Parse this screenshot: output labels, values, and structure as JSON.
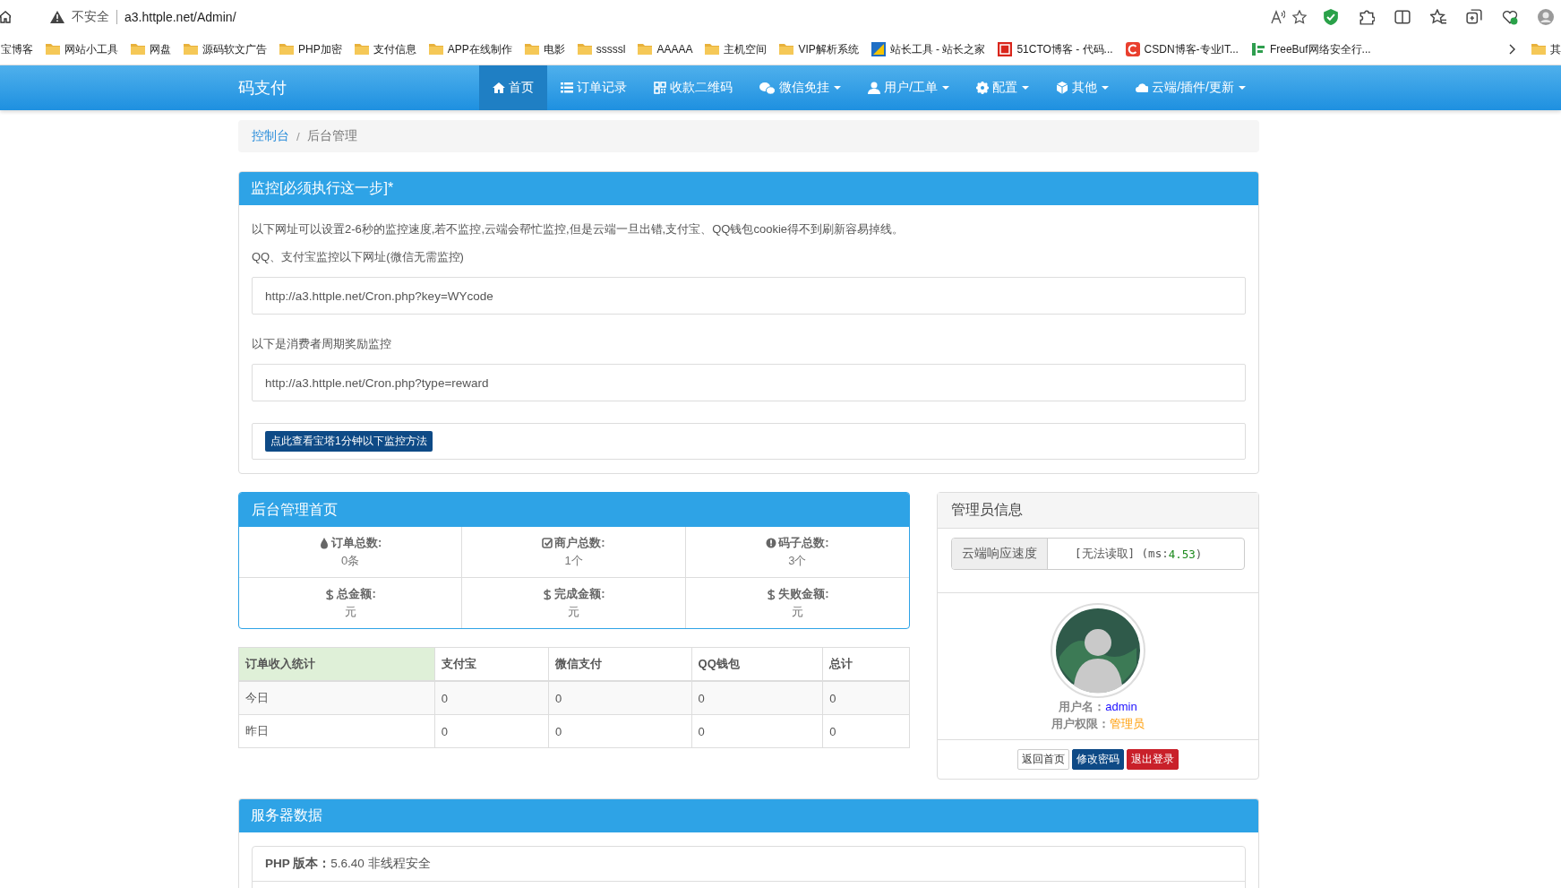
{
  "browser": {
    "address_warning": "不安全",
    "url": "a3.httple.net/Admin/",
    "bookmarks": [
      {
        "label": "宝博客",
        "kind": "none"
      },
      {
        "label": "网站小工具",
        "kind": "folder"
      },
      {
        "label": "网盘",
        "kind": "folder"
      },
      {
        "label": "源码软文广告",
        "kind": "folder"
      },
      {
        "label": "PHP加密",
        "kind": "folder"
      },
      {
        "label": "支付信息",
        "kind": "folder"
      },
      {
        "label": "APP在线制作",
        "kind": "folder"
      },
      {
        "label": "电影",
        "kind": "folder"
      },
      {
        "label": "sssssl",
        "kind": "folder"
      },
      {
        "label": "AAAAA",
        "kind": "folder"
      },
      {
        "label": "主机空间",
        "kind": "folder"
      },
      {
        "label": "VIP解析系统",
        "kind": "folder"
      },
      {
        "label": "站长工具 - 站长之家",
        "kind": "chart"
      },
      {
        "label": "51CTO博客 - 代码...",
        "kind": "square"
      },
      {
        "label": "CSDN博客-专业IT...",
        "kind": "ring"
      },
      {
        "label": "FreeBuf网络安全行...",
        "kind": "bars"
      }
    ],
    "overflow_folder": "其"
  },
  "navbar": {
    "brand": "码支付",
    "items": [
      {
        "label": "首页",
        "dropdown": false,
        "selected": true
      },
      {
        "label": "订单记录",
        "dropdown": false,
        "selected": false
      },
      {
        "label": "收款二维码",
        "dropdown": false,
        "selected": false
      },
      {
        "label": "微信免挂",
        "dropdown": true,
        "selected": false
      },
      {
        "label": "用户/工单",
        "dropdown": true,
        "selected": false
      },
      {
        "label": "配置",
        "dropdown": true,
        "selected": false
      },
      {
        "label": "其他",
        "dropdown": true,
        "selected": false
      },
      {
        "label": "云端/插件/更新",
        "dropdown": true,
        "selected": false
      }
    ]
  },
  "breadcrumb": {
    "separator": "/",
    "items": [
      {
        "label": "控制台",
        "link": true
      },
      {
        "label": "后台管理",
        "link": false
      }
    ]
  },
  "monitor": {
    "title": "监控[必须执行这一步]*",
    "note": "以下网址可以设置2-6秒的监控速度,若不监控,云端会帮忙监控,但是云端一旦出错,支付宝、QQ钱包cookie得不到刷新容易掉线。",
    "fields": [
      {
        "label": "QQ、支付宝监控以下网址(微信无需监控)",
        "value": "http://a3.httple.net/Cron.php?key=WYcode"
      },
      {
        "label": "以下是消费者周期奖励监控",
        "value": "http://a3.httple.net/Cron.php?type=reward"
      }
    ],
    "button": "点此查看宝塔1分钟以下监控方法"
  },
  "dashboard": {
    "title": "后台管理首页",
    "stats": [
      {
        "label": "订单总数:",
        "value": "0条"
      },
      {
        "label": "商户总数:",
        "value": "1个"
      },
      {
        "label": "码子总数:",
        "value": "3个"
      },
      {
        "label": "总金额:",
        "value": "元"
      },
      {
        "label": "完成金额:",
        "value": "元"
      },
      {
        "label": "失败金额:",
        "value": "元"
      }
    ],
    "income_table": {
      "columns": [
        {
          "label": "订单收入统计",
          "highlighted": true
        },
        {
          "label": "支付宝",
          "highlighted": false
        },
        {
          "label": "微信支付",
          "highlighted": false
        },
        {
          "label": "QQ钱包",
          "highlighted": false
        },
        {
          "label": "总计",
          "highlighted": false
        }
      ],
      "rows": [
        [
          "今日",
          "0",
          "0",
          "0",
          "0"
        ],
        [
          "昨日",
          "0",
          "0",
          "0",
          "0"
        ]
      ]
    }
  },
  "admin": {
    "title": "管理员信息",
    "speed": {
      "label": "云端响应速度",
      "status": "[无法读取] (ms:",
      "ms": "4.53",
      "suffix": ")"
    },
    "username_label": "用户名：",
    "username": "admin",
    "role_label": "用户权限：",
    "role": "管理员",
    "buttons": [
      {
        "label": "返回首页",
        "kind": "default"
      },
      {
        "label": "修改密码",
        "kind": "primary"
      },
      {
        "label": "退出登录",
        "kind": "danger"
      }
    ]
  },
  "server": {
    "title": "服务器数据",
    "rows": [
      {
        "text": "**PHP 版本：**5.6.40 非线程安全"
      }
    ]
  }
}
